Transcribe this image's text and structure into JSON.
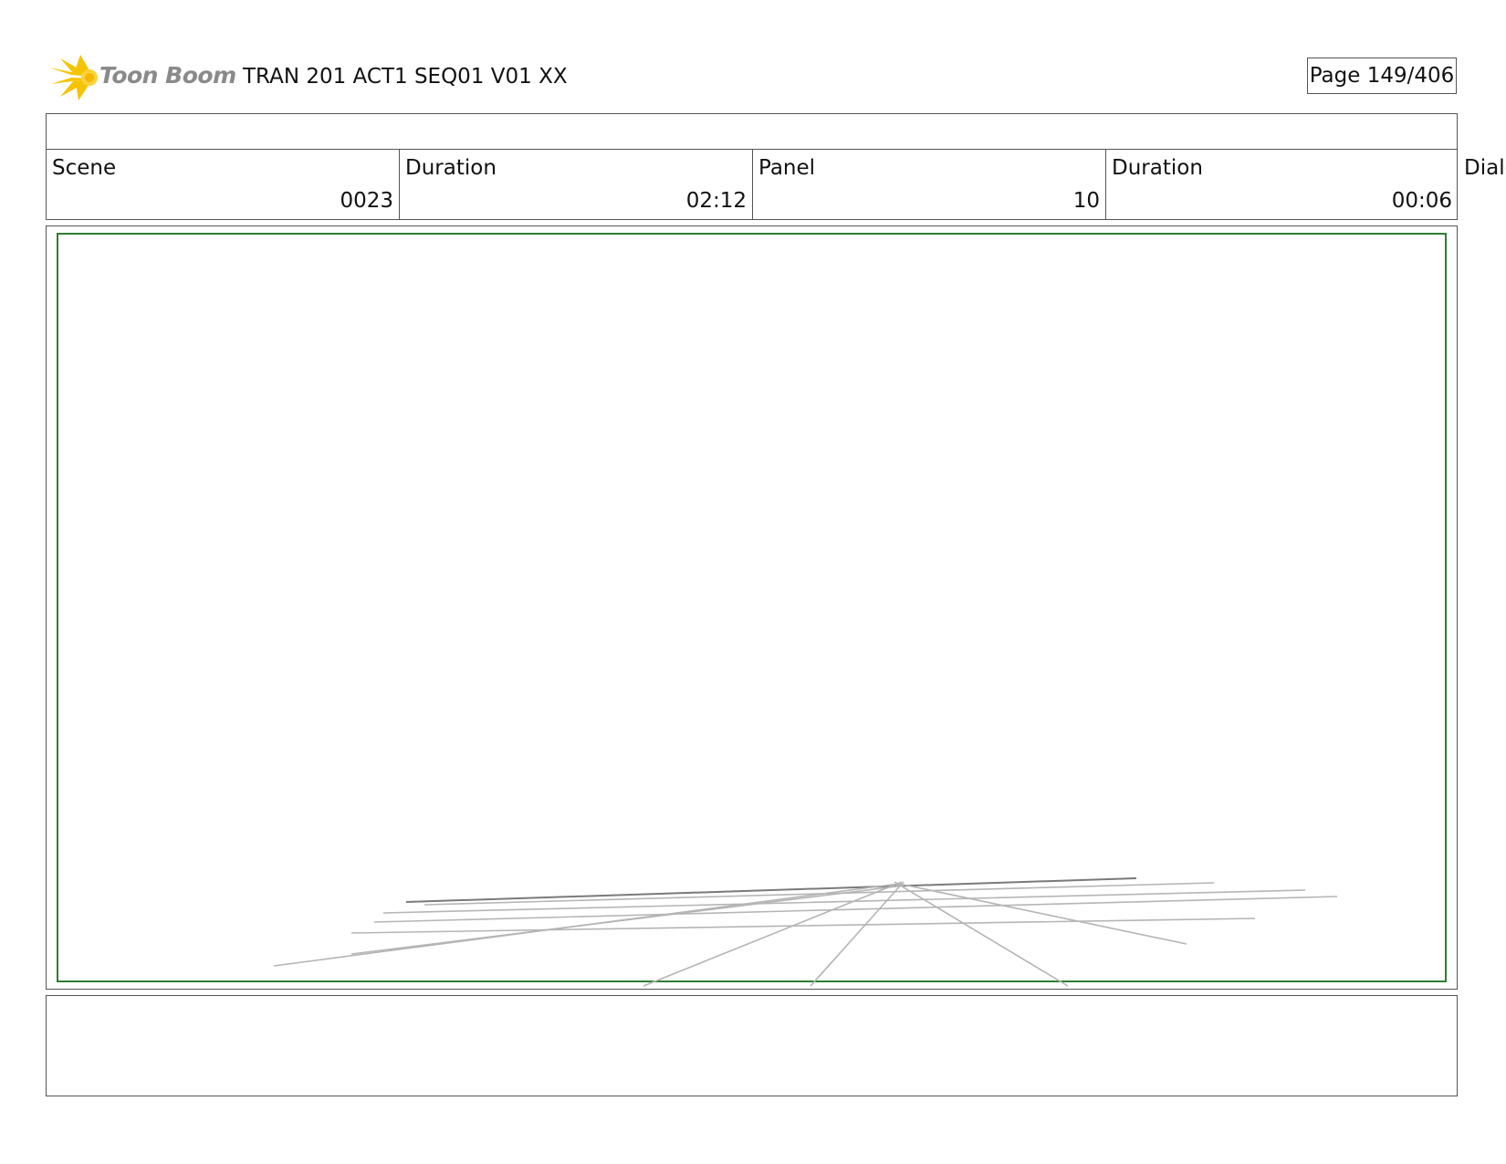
{
  "header": {
    "logo_text": "Toon Boom",
    "project_title": "TRAN 201 ACT1 SEQ01 V01 XX",
    "page_label": "Page 149/406"
  },
  "info": {
    "scene_label": "Scene",
    "scene_value": "0023",
    "scene_duration_label": "Duration",
    "scene_duration_value": "02:12",
    "panel_label": "Panel",
    "panel_value": "10",
    "panel_duration_label": "Duration",
    "panel_duration_value": "00:06",
    "dialog_label": "Dialo"
  },
  "colors": {
    "safe_frame": "#2e7d32",
    "logo_yellow": "#f5c400",
    "logo_text": "#8a8a8a"
  }
}
